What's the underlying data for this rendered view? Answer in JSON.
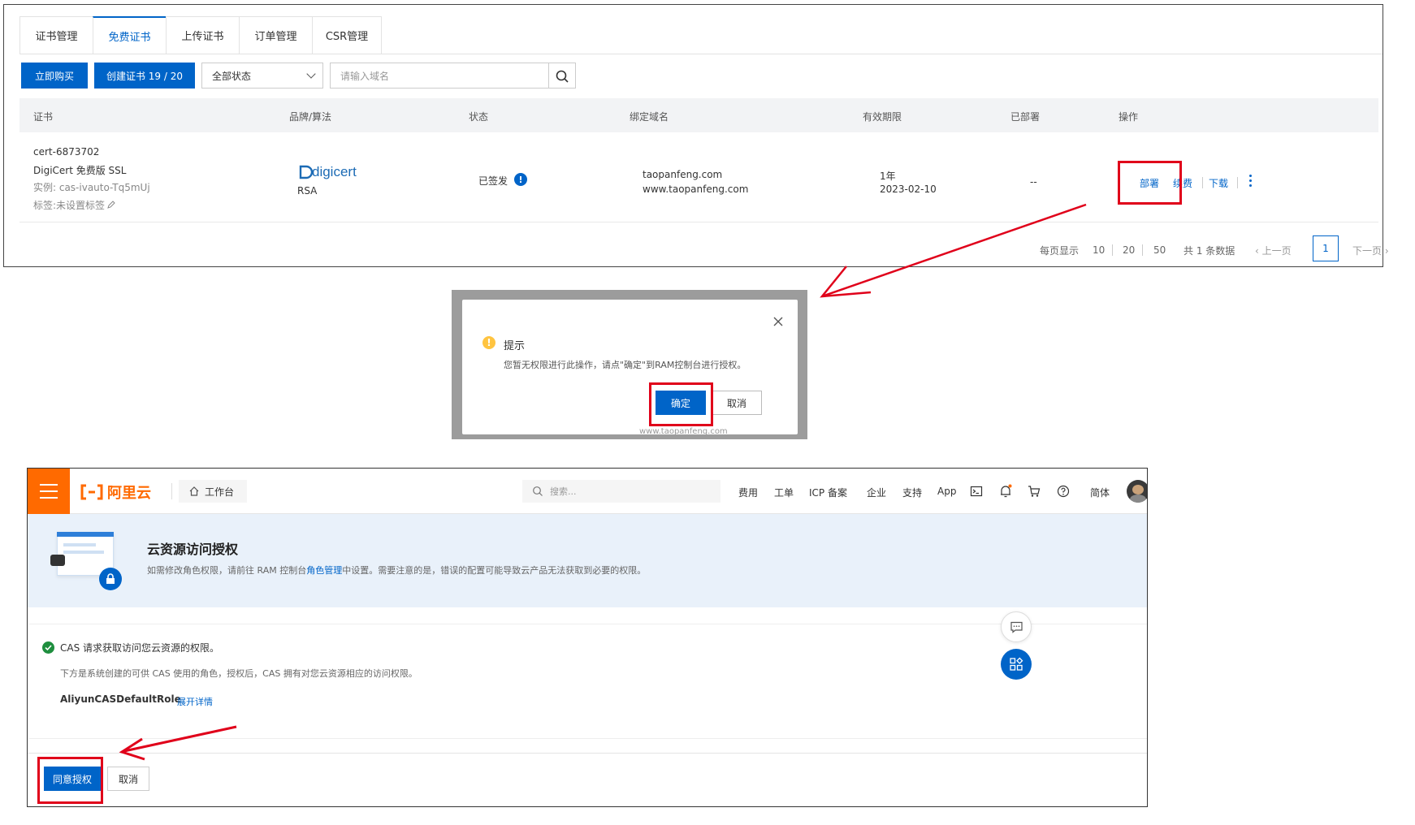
{
  "cert_console": {
    "tabs": [
      "证书管理",
      "免费证书",
      "上传证书",
      "订单管理",
      "CSR管理"
    ],
    "active_tab": "免费证书",
    "toolbar": {
      "buy_label": "立即购买",
      "create_label": "创建证书 19 / 20",
      "status_filter": "全部状态",
      "search_placeholder": "请输入域名"
    },
    "columns": [
      "证书",
      "品牌/算法",
      "状态",
      "绑定域名",
      "有效期限",
      "已部署",
      "操作"
    ],
    "row": {
      "cert_id": "cert-6873702",
      "cert_name": "DigiCert 免费版 SSL",
      "instance": "实例: cas-ivauto-Tq5mUj",
      "tag": "标签:未设置标签",
      "brand_logo": "digicert",
      "algorithm": "RSA",
      "status": "已签发",
      "domains": [
        "taopanfeng.com",
        "www.taopanfeng.com"
      ],
      "validity": "1年",
      "expire_date": "2023-02-10",
      "deployed": "--",
      "actions": {
        "deploy": "部署",
        "renew": "续费",
        "download": "下载"
      }
    },
    "pagination": {
      "page_size_label": "每页显示",
      "sizes": [
        "10",
        "20",
        "50"
      ],
      "total": "共 1 条数据",
      "prev": "上一页",
      "current": "1",
      "next": "下一页"
    }
  },
  "dialog": {
    "title": "提示",
    "message": "您暂无权限进行此操作，请点\"确定\"到RAM控制台进行授权。",
    "ok_label": "确定",
    "cancel_label": "取消",
    "bg_text": "www.taopanfeng.com"
  },
  "aliyun": {
    "logo_text": "阿里云",
    "workbench": "工作台",
    "search_placeholder": "搜索...",
    "nav": [
      "费用",
      "工单",
      "ICP 备案",
      "企业",
      "支持",
      "App"
    ],
    "lang": "简体",
    "banner_title": "云资源访问授权",
    "banner_desc_pre": "如需修改角色权限，请前往 RAM 控制台",
    "banner_desc_link": "角色管理",
    "banner_desc_post": "中设置。需要注意的是，错误的配置可能导致云产品无法获取到必要的权限。",
    "request_title": "CAS 请求获取访问您云资源的权限。",
    "request_desc": "下方是系统创建的可供 CAS 使用的角色，授权后，CAS 拥有对您云资源相应的访问权限。",
    "role_name": "AliyunCASDefaultRole",
    "expand_label": "展开详情",
    "agree_label": "同意授权",
    "cancel_label": "取消"
  },
  "colors": {
    "primary": "#0064c8",
    "orange": "#ff6a00",
    "annotation_red": "#e0001a",
    "warning": "#ffc440",
    "success": "#1e8e3e"
  }
}
